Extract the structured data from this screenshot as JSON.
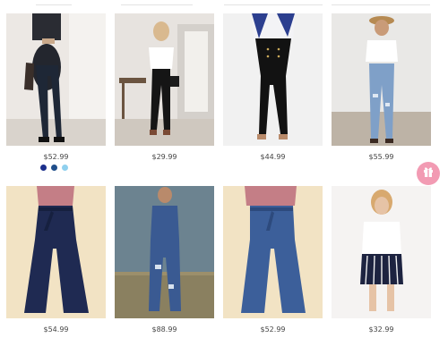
{
  "products": [
    {
      "price": "$52.99",
      "image": "woman-in-dark-skinny-jeans"
    },
    {
      "price": "$29.99",
      "image": "woman-in-black-leggings-white-top"
    },
    {
      "price": "$44.99",
      "image": "woman-in-black-high-waist-pants"
    },
    {
      "price": "$55.99",
      "image": "woman-in-ripped-light-jeans"
    },
    {
      "price": "$54.99",
      "image": "navy-flare-jeans-belted"
    },
    {
      "price": "$88.99",
      "image": "denim-overalls-outdoors"
    },
    {
      "price": "$52.99",
      "image": "blue-flare-jeans-belted"
    },
    {
      "price": "$32.99",
      "image": "striped-shorts-lace-top"
    }
  ],
  "swatches": [
    "#1b2f8c",
    "#1f4e8a",
    "#8fd0ee"
  ],
  "gift_button": {
    "icon": "gift-icon",
    "color": "#f29bb3"
  }
}
